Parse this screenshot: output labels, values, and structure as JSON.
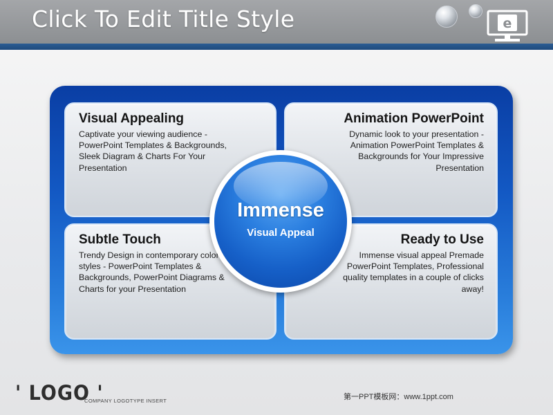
{
  "slide": {
    "title": "Click To Edit Title Style"
  },
  "diagram": {
    "center": {
      "title": "Immense",
      "subtitle": "Visual Appeal"
    },
    "quadrants": [
      {
        "title": "Visual Appealing",
        "body": "Captivate your viewing audience - PowerPoint Templates & Backgrounds, Sleek Diagram & Charts For Your Presentation"
      },
      {
        "title": "Animation PowerPoint",
        "body": "Dynamic look to your presentation - Animation PowerPoint Templates & Backgrounds for Your Impressive Presentation"
      },
      {
        "title": "Subtle Touch",
        "body": "Trendy Design in contemporary colors and styles - PowerPoint Templates & Backgrounds, PowerPoint Diagrams & Charts for your Presentation"
      },
      {
        "title": "Ready to Use",
        "body": "Immense visual appeal Premade PowerPoint Templates, Professional quality templates in a couple of clicks away!"
      }
    ]
  },
  "footer": {
    "logo": "' LOGO '",
    "logo_tagline": "COMPANY LOGOTYPE INSERT",
    "site": "第一PPT模板网：www.1ppt.com"
  },
  "icons": {
    "monitor": "monitor-e-icon",
    "bubbles": "bubble-icon"
  },
  "colors": {
    "title_bar": "#8c8f92",
    "title_stripe": "#1f4a7c",
    "frame_blue": "#1359c4",
    "center_blue": "#2b7fe0"
  }
}
